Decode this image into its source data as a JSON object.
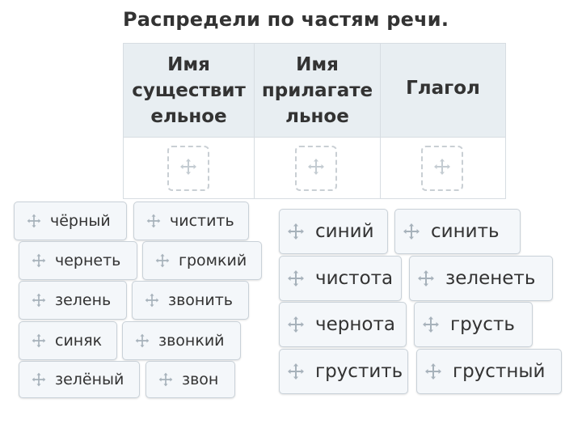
{
  "title": "Распредели по частям речи.",
  "columns": [
    {
      "lines": [
        "Имя",
        "существит",
        "ельное"
      ]
    },
    {
      "lines": [
        "Имя",
        "прилагате",
        "льное"
      ]
    },
    {
      "lines": [
        "Глагол"
      ]
    }
  ],
  "cards": [
    {
      "text": "чёрный"
    },
    {
      "text": "чистить"
    },
    {
      "text": "чернеть"
    },
    {
      "text": "громкий"
    },
    {
      "text": "зелень"
    },
    {
      "text": "звонить"
    },
    {
      "text": "синяк"
    },
    {
      "text": "звонкий"
    },
    {
      "text": "зелёный"
    },
    {
      "text": "звон"
    },
    {
      "text": "синий"
    },
    {
      "text": "синить"
    },
    {
      "text": "чистота"
    },
    {
      "text": "зеленеть"
    },
    {
      "text": "чернота"
    },
    {
      "text": "грусть"
    },
    {
      "text": "грустить"
    },
    {
      "text": "грустный"
    }
  ],
  "colors": {
    "header_bg": "#e8eef2",
    "card_bg": "#f4f7fa",
    "border": "#d7dde2",
    "icon": "#a7b2bb"
  },
  "icons": {
    "drag": "move-arrows-icon"
  }
}
